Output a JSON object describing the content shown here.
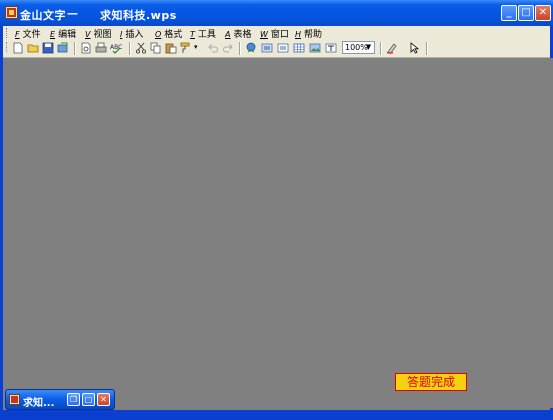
{
  "window": {
    "app_name": "金山文字",
    "separator": "—",
    "document_name": "求知科技.wps",
    "minimize_label": "_",
    "maximize_label": "□",
    "close_label": "✕"
  },
  "menu": [
    {
      "mnemonic": "F",
      "label": "文件"
    },
    {
      "mnemonic": "E",
      "label": "编辑"
    },
    {
      "mnemonic": "V",
      "label": "视图"
    },
    {
      "mnemonic": "I",
      "label": "插入"
    },
    {
      "mnemonic": "O",
      "label": "格式"
    },
    {
      "mnemonic": "T",
      "label": "工具"
    },
    {
      "mnemonic": "A",
      "label": "表格"
    },
    {
      "mnemonic": "W",
      "label": "窗口"
    },
    {
      "mnemonic": "H",
      "label": "帮助"
    }
  ],
  "toolbar": {
    "icons": [
      "new-icon",
      "open-icon",
      "save-icon",
      "mail-icon",
      "print-preview-icon",
      "print-icon",
      "spellcheck-icon",
      "cut-icon",
      "copy-icon",
      "paste-icon",
      "format-painter-icon",
      "undo-icon",
      "redo-icon",
      "hyperlink-icon",
      "image-icon",
      "frame-icon",
      "table-icon",
      "picture-icon",
      "text-box-icon",
      "zoom-select",
      "highlight-icon",
      "pointer-icon"
    ],
    "zoom_value": "100%",
    "zoom_arrow": "▼"
  },
  "status": {
    "done_label": "答题完成"
  },
  "taskbar": {
    "label": "求知...",
    "restore_label": "❐",
    "maximize_label": "□",
    "close_label": "✕"
  },
  "colors": {
    "titlebar": "#0656e3",
    "workspace": "#808080",
    "done_bg": "#f5d10f",
    "done_text": "#e00000"
  }
}
